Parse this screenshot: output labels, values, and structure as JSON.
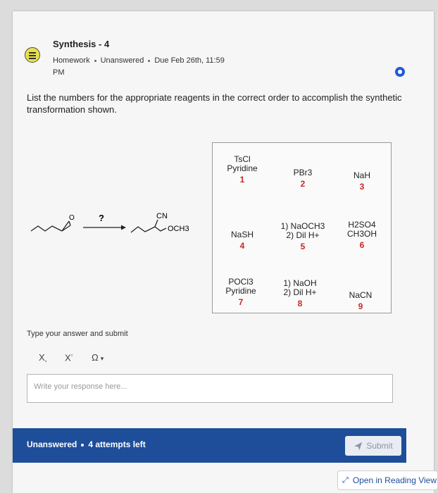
{
  "assignment": {
    "title": "Synthesis - 4",
    "type": "Homework",
    "status": "Unanswered",
    "due": "Due Feb 26th, 11:59",
    "due_suffix": "PM"
  },
  "question": {
    "prompt": "List the numbers for the appropriate reagents in the correct order to accomplish the synthetic transformation shown."
  },
  "scheme": {
    "arrow_label": "?",
    "product_substituent_top": "CN",
    "product_substituent_right": "OCH3"
  },
  "reagents": [
    {
      "lines": [
        "TsCl",
        "Pyridine"
      ],
      "number": "1"
    },
    {
      "lines": [
        "PBr3"
      ],
      "number": "2"
    },
    {
      "lines": [
        "NaH"
      ],
      "number": "3"
    },
    {
      "lines": [
        "NaSH"
      ],
      "number": "4"
    },
    {
      "lines": [
        "1) NaOCH3",
        "2) Dil H+"
      ],
      "number": "5"
    },
    {
      "lines": [
        "H2SO4",
        "CH3OH"
      ],
      "number": "6"
    },
    {
      "lines": [
        "POCl3",
        "Pyridine"
      ],
      "number": "7"
    },
    {
      "lines": [
        "1) NaOH",
        "2) Dil H+"
      ],
      "number": "8"
    },
    {
      "lines": [
        "NaCN"
      ],
      "number": "9"
    }
  ],
  "answer": {
    "label": "Type your answer and submit",
    "subscript_btn": "X",
    "superscript_btn": "X",
    "symbol_btn": "Ω",
    "placeholder": "Write your response here..."
  },
  "footer": {
    "status": "Unanswered",
    "attempts": "4 attempts left",
    "submit_label": "Submit",
    "reading_view": "Open in Reading View"
  },
  "colors": {
    "accent": "#1e4e9a",
    "reagent_number": "#c62828",
    "icon_fill": "#e8e14a"
  },
  "icons": [
    "homework-icon",
    "status-dot-icon",
    "omega-icon",
    "chevron-down-icon",
    "send-icon",
    "expand-icon"
  ]
}
